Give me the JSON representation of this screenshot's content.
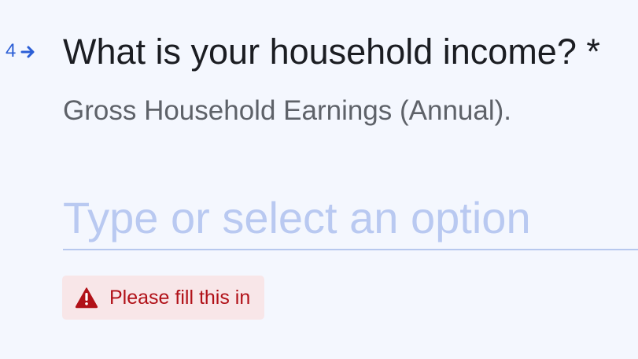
{
  "question": {
    "number": "4",
    "title": "What is your household income? *",
    "description": "Gross Household Earnings (Annual).",
    "icon": "arrow-right-icon"
  },
  "answer": {
    "placeholder": "Type or select an option",
    "value": ""
  },
  "validation": {
    "message": "Please fill this in",
    "icon": "warning-icon"
  },
  "colors": {
    "background": "#f4f7fe",
    "accent": "#2c5fd6",
    "placeholder": "#b9c9f1",
    "error_text": "#b11118",
    "error_background": "#f8e6e8"
  }
}
